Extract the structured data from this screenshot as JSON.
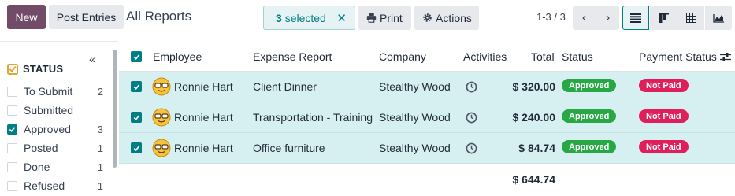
{
  "toolbar": {
    "new_label": "New",
    "post_label": "Post Entries",
    "title": "All Reports",
    "selected_count": "3",
    "selected_suffix": "selected",
    "print_label": "Print",
    "actions_label": "Actions",
    "pager": "1-3 / 3"
  },
  "views": [
    "list-view-icon",
    "kanban-view-icon",
    "pivot-view-icon",
    "graph-view-icon"
  ],
  "sidebar": {
    "title": "STATUS",
    "items": [
      {
        "label": "To Submit",
        "count": "2",
        "checked": false
      },
      {
        "label": "Submitted",
        "count": "",
        "checked": false
      },
      {
        "label": "Approved",
        "count": "3",
        "checked": true
      },
      {
        "label": "Posted",
        "count": "1",
        "checked": false
      },
      {
        "label": "Done",
        "count": "1",
        "checked": false
      },
      {
        "label": "Refused",
        "count": "1",
        "checked": false
      }
    ]
  },
  "table": {
    "columns": {
      "employee": "Employee",
      "report": "Expense Report",
      "company": "Company",
      "activities": "Activities",
      "total": "Total",
      "status": "Status",
      "payment_status": "Payment Status"
    },
    "rows": [
      {
        "employee": "Ronnie Hart",
        "report": "Client Dinner",
        "company": "Stealthy Wood",
        "total": "$ 320.00",
        "status": "Approved",
        "payment_status": "Not Paid"
      },
      {
        "employee": "Ronnie Hart",
        "report": "Transportation - Training",
        "company": "Stealthy Wood",
        "total": "$ 240.00",
        "status": "Approved",
        "payment_status": "Not Paid"
      },
      {
        "employee": "Ronnie Hart",
        "report": "Office furniture",
        "company": "Stealthy Wood",
        "total": "$ 84.74",
        "status": "Approved",
        "payment_status": "Not Paid"
      }
    ],
    "grand_total": "$ 644.74"
  },
  "colors": {
    "primary": "#714B67",
    "accent": "#017e84",
    "selected_row": "#d6f0f1",
    "approved": "#28a745",
    "not_paid": "#e01e5a"
  }
}
